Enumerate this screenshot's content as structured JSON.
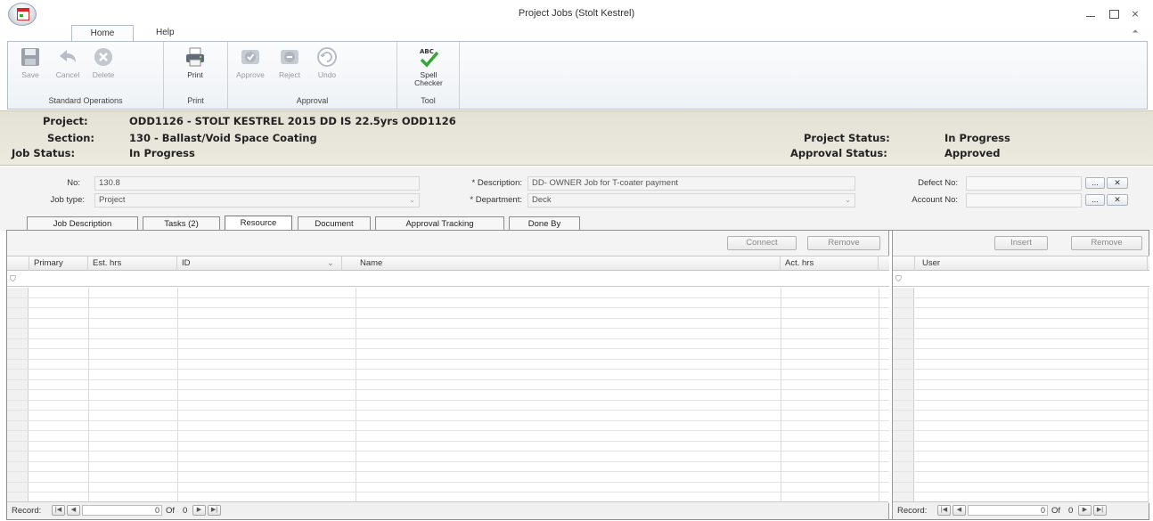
{
  "window": {
    "title": "Project Jobs (Stolt Kestrel)",
    "min_glyph": "",
    "close_glyph": "⨯",
    "collapse_glyph": "⏶"
  },
  "ribbon": {
    "tabs": [
      {
        "label": "Home",
        "active": true
      },
      {
        "label": "Help",
        "active": false
      }
    ],
    "groups": {
      "standard_operations": "Standard Operations",
      "print": "Print",
      "approval": "Approval",
      "tool": "Tool"
    },
    "buttons": {
      "save": "Save",
      "cancel": "Cancel",
      "delete": "Delete",
      "print": "Print",
      "approve": "Approve",
      "reject": "Reject",
      "undo": "Undo",
      "spell_checker": "Spell Checker",
      "spell_icon_text": "ABC"
    }
  },
  "header": {
    "project_label": "Project:",
    "project_value": "ODD1126 - STOLT KESTREL 2015 DD IS 22.5yrs ODD1126",
    "section_label": "Section:",
    "section_value": "130 - Ballast/Void Space Coating",
    "job_status_label": "Job Status:",
    "job_status_value": "In Progress",
    "project_status_label": "Project Status:",
    "project_status_value": "In Progress",
    "approval_status_label": "Approval Status:",
    "approval_status_value": "Approved"
  },
  "form": {
    "no_label": "No:",
    "no_value": "130.8",
    "job_type_label": "Job type:",
    "job_type_value": "Project",
    "description_label": "* Description:",
    "description_value": "DD- OWNER Job for T-coater payment",
    "department_label": "* Department:",
    "department_value": "Deck",
    "defect_no_label": "Defect No:",
    "account_no_label": "Account No:",
    "browse_glyph": "...",
    "clear_glyph": "✕"
  },
  "tabs": [
    {
      "label": "Job Description",
      "active": false
    },
    {
      "label": "Tasks (2)",
      "active": false
    },
    {
      "label": "Resource",
      "active": true
    },
    {
      "label": "Document",
      "active": false
    },
    {
      "label": "Approval Tracking",
      "active": false
    },
    {
      "label": "Done By",
      "active": false
    }
  ],
  "resource_grid": {
    "connect_label": "Connect",
    "remove_label": "Remove",
    "columns": [
      "Primary",
      "Est. hrs",
      "ID",
      "Name",
      "Act. hrs"
    ],
    "rows": []
  },
  "user_grid": {
    "insert_label": "Insert",
    "remove_label": "Remove",
    "columns": [
      "User"
    ],
    "rows": []
  },
  "navigator": {
    "record_label": "Record:",
    "current": "0",
    "of_label": "Of",
    "total": "0"
  },
  "icons": {
    "funnel": "⛉",
    "first": "|◀",
    "prev": "◀",
    "next": "▶",
    "last": "▶|",
    "dropdown": "⌄"
  }
}
